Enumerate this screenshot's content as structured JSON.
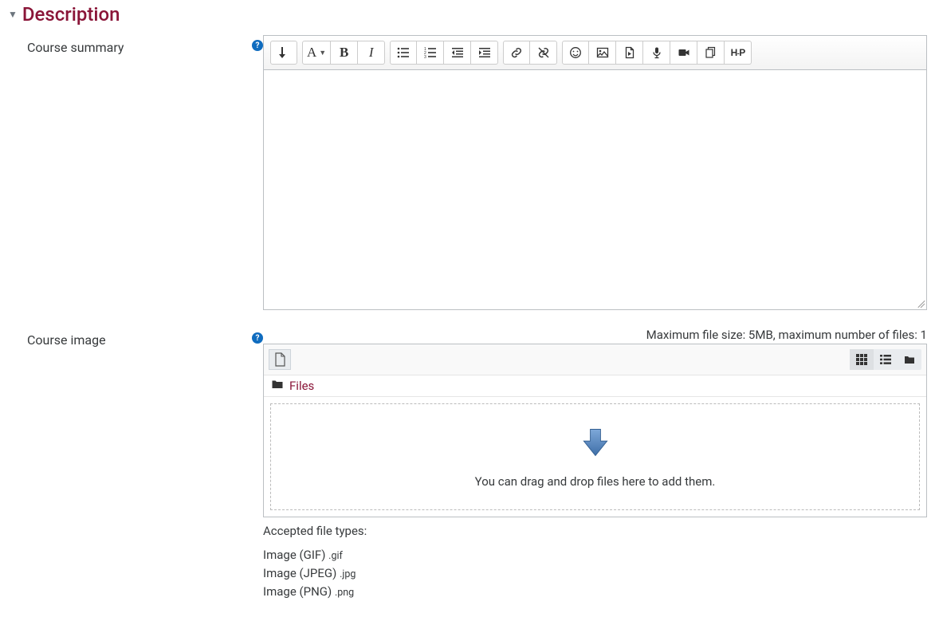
{
  "section": {
    "title": "Description"
  },
  "summary": {
    "label": "Course summary"
  },
  "image": {
    "label": "Course image",
    "file_size_info": "Maximum file size: 5MB, maximum number of files: 1",
    "path_label": "Files",
    "drop_text": "You can drag and drop files here to add them.",
    "accepted_label": "Accepted file types:",
    "types": [
      {
        "label": "Image (GIF)",
        "ext": ".gif"
      },
      {
        "label": "Image (JPEG)",
        "ext": ".jpg"
      },
      {
        "label": "Image (PNG)",
        "ext": ".png"
      }
    ]
  },
  "toolbar": {
    "expand": "↓",
    "h5p": "H-P"
  }
}
